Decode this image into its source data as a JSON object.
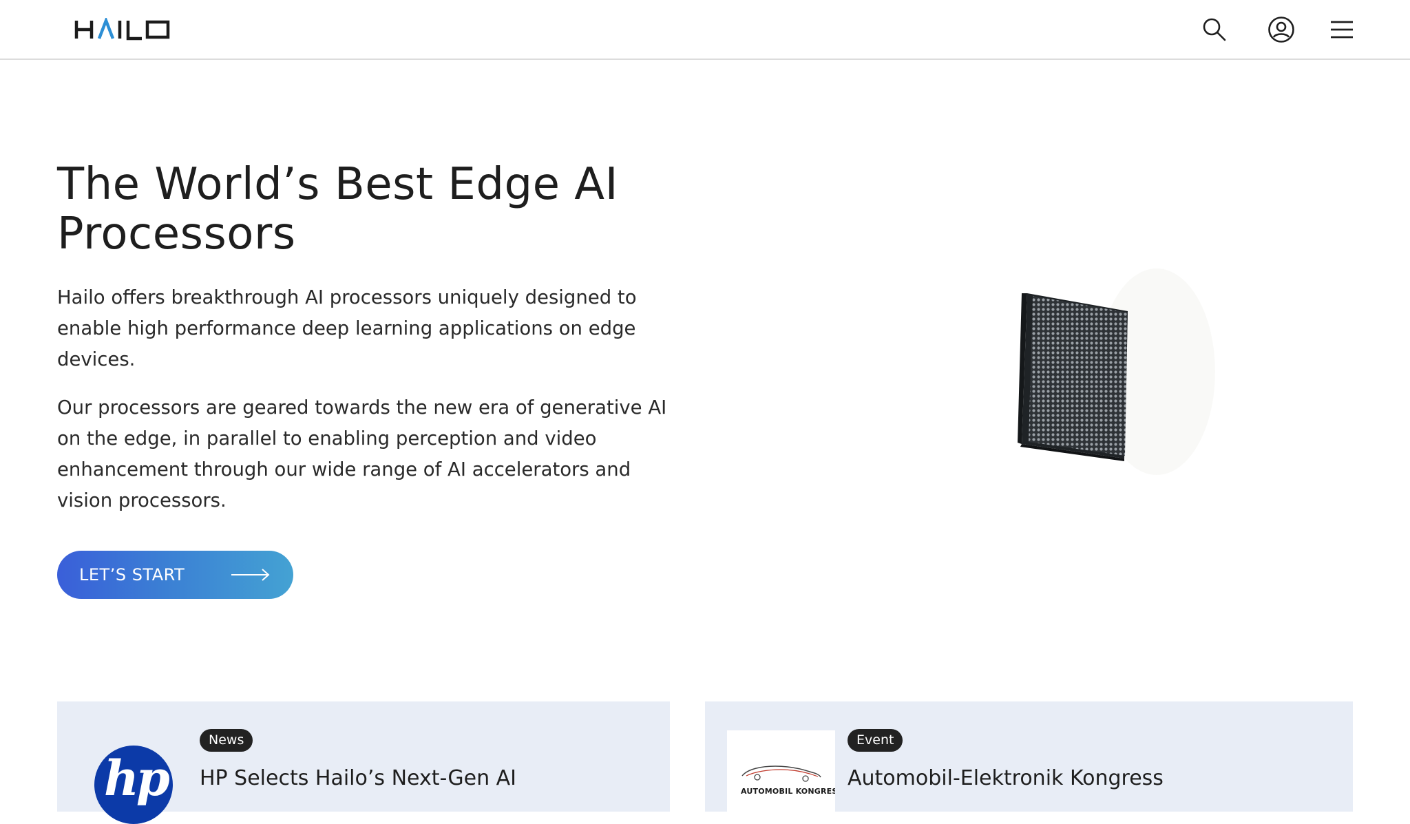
{
  "header": {
    "logo_text": "HAILO",
    "icons": [
      "search-icon",
      "user-icon",
      "hamburger-menu-icon"
    ]
  },
  "hero": {
    "title": "The World’s Best Edge AI Processors",
    "paragraph_1": "Hailo offers breakthrough AI processors uniquely designed to enable high performance deep learning applications on edge devices.",
    "paragraph_2": "Our processors are geared towards the new era of generative AI on the edge, in parallel to enabling perception and video enhancement through our wide range of AI accelerators and vision processors.",
    "cta_label": "LET’S START",
    "cta_icon": "arrow-right-icon",
    "image": "ai-processor-chip-image"
  },
  "cards": [
    {
      "badge": "News",
      "title": "HP Selects Hailo’s Next-Gen AI",
      "logo": "hp-logo",
      "logo_text": "hp"
    },
    {
      "badge": "Event",
      "title": "Automobil-Elektronik Kongress",
      "logo": "automobil-kongress-logo",
      "logo_text": "AUTOMOBIL KONGRESS"
    }
  ],
  "colors": {
    "accent_gradient_start": "#3a5fd9",
    "accent_gradient_end": "#44a2d3",
    "card_background": "#e8edf6",
    "badge_background": "#222222",
    "logo_accent": "#2d8fd5",
    "hp_blue": "#0c3aa8"
  }
}
